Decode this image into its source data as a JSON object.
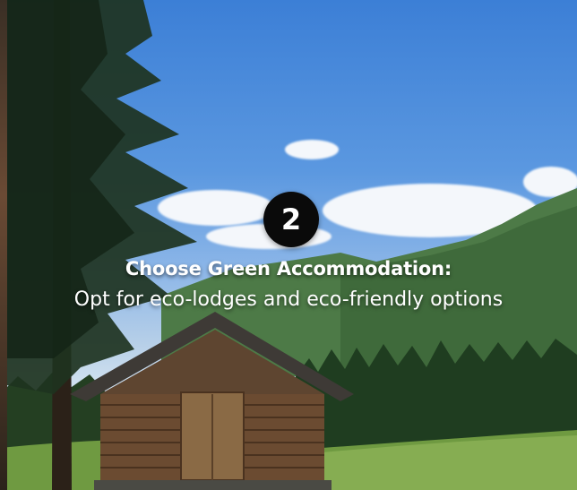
{
  "step": {
    "number": "2"
  },
  "caption": {
    "title": "Choose Green Accommodation:",
    "subtitle": "Opt for eco-lodges and eco-friendly options"
  },
  "colors": {
    "sky": "#4a8adb",
    "forest": "#2f5a2c",
    "meadow": "#7aa148",
    "cabin": "#6a4a30",
    "badge": "#0a0a0a"
  }
}
